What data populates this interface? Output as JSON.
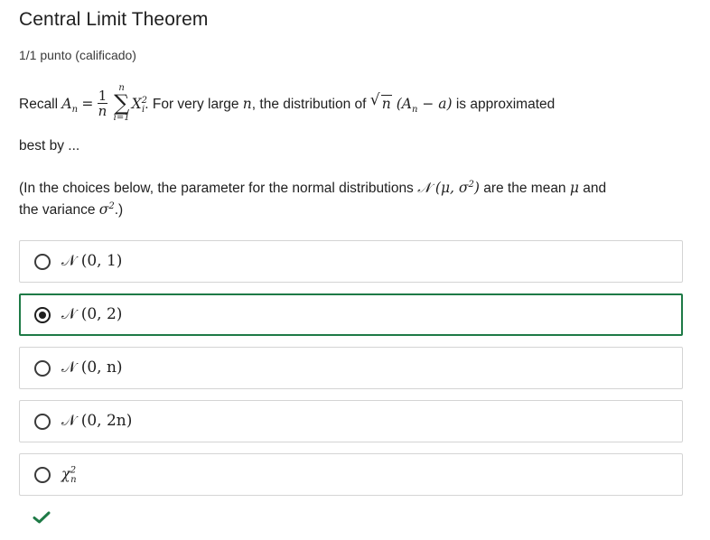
{
  "question": {
    "title": "Central Limit Theorem",
    "score": "1/1 punto (calificado)",
    "p1_recall": "Recall",
    "p1_A": "A",
    "p1_n_sub": "n",
    "p1_eq": "=",
    "frac_num": "1",
    "frac_den": "n",
    "sum_top": "n",
    "sum_bot": "i=1",
    "sum_sym": "∑",
    "p1_X": "X",
    "p1_X_sup": "2",
    "p1_X_sub": "i",
    "p1_dot": ".",
    "p1_mid": "For very large",
    "p1_n": "n",
    "p1_mid2": ", the distribution of",
    "sqrt_rad": "√",
    "sqrt_in": "n",
    "p1_paren": "(A",
    "p1_paren_sub": "n",
    "p1_minus_a": " − a)",
    "p1_end": "is approximated",
    "p2": "best by ...",
    "p3_a": "(In the choices below, the parameter for the normal distributions",
    "p3_N": "𝒩",
    "p3_musig": " (μ, σ",
    "p3_sup2": "2",
    "p3_close": ")",
    "p3_b": "are the mean",
    "p3_mu": "μ",
    "p3_c": "and",
    "p4_a": "the variance",
    "p4_sigma": "σ",
    "p4_sup": "2",
    "p4_end": ".)"
  },
  "options": [
    {
      "label": "𝒩 (0, 1)",
      "selected": false
    },
    {
      "label": "𝒩 (0, 2)",
      "selected": true
    },
    {
      "label": "𝒩 (0, n)",
      "selected": false
    },
    {
      "label": "𝒩 (0, 2n)",
      "selected": false
    },
    {
      "label": "χ",
      "sup": "2",
      "sub": "n",
      "selected": false
    }
  ],
  "colors": {
    "selected_border": "#1e7a46",
    "check": "#1e7a46"
  },
  "status": {
    "icon": "checkmark-icon"
  }
}
